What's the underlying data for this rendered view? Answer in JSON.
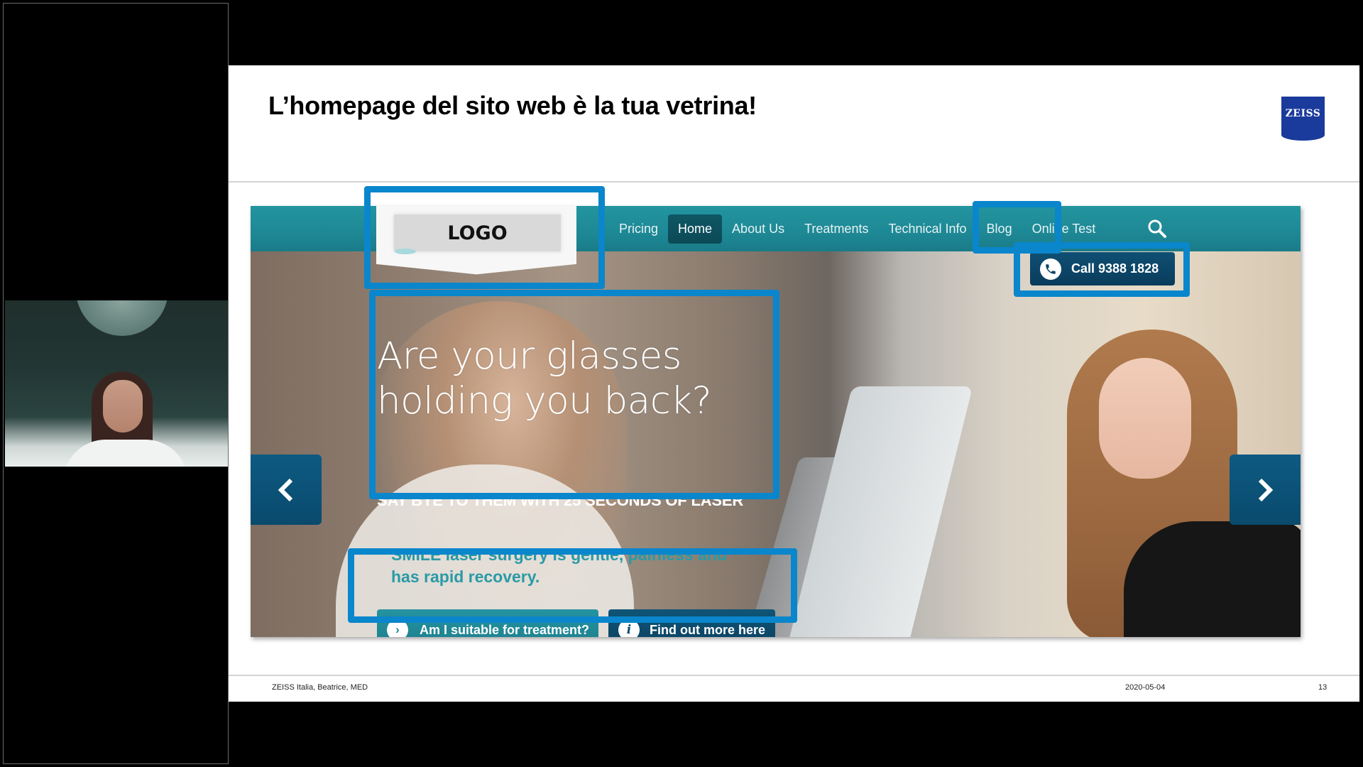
{
  "meeting": {
    "participant_video": {
      "label": "presenter-webcam"
    }
  },
  "slide": {
    "title": "L’homepage del sito web è la tua vetrina!",
    "brand_logo_text": "ZEISS",
    "brand_color": "#1a3a9c",
    "highlight_color": "#0a86cc",
    "footer": {
      "left": "ZEISS Italia, Beatrice, MED",
      "date": "2020-05-04",
      "page_number": "13"
    }
  },
  "website": {
    "logo_text": "LOGO",
    "nav": {
      "items": [
        {
          "label": "Pricing",
          "active": false
        },
        {
          "label": "Home",
          "active": true
        },
        {
          "label": "About Us",
          "active": false
        },
        {
          "label": "Treatments",
          "active": false
        },
        {
          "label": "Technical Info",
          "active": false
        },
        {
          "label": "Blog",
          "active": false
        },
        {
          "label": "Online Test",
          "active": false
        }
      ],
      "search_icon": "search-icon"
    },
    "call_button": {
      "label": "Call 9388 1828",
      "icon": "phone-icon"
    },
    "hero": {
      "headline": "Are your glasses holding you back?",
      "subheadline": "SAY BYE TO THEM WITH 25 SECONDS OF LASER",
      "description": "SMILE laser surgery is gentle, painless and has rapid recovery.",
      "cta_primary": {
        "label": "Am I suitable for treatment?",
        "icon": "chevron-right-circle-icon",
        "glyph": "›"
      },
      "cta_secondary": {
        "label": "Find out more here",
        "icon": "info-icon",
        "glyph": "i"
      },
      "prev_icon": "chevron-left-icon",
      "next_icon": "chevron-right-icon"
    },
    "colors": {
      "nav_bg": "#1e8895",
      "active_nav": "#0f5664",
      "dark_button": "#0c4566",
      "teal_button": "#2190a0",
      "description_text": "#2a9aa6"
    }
  }
}
